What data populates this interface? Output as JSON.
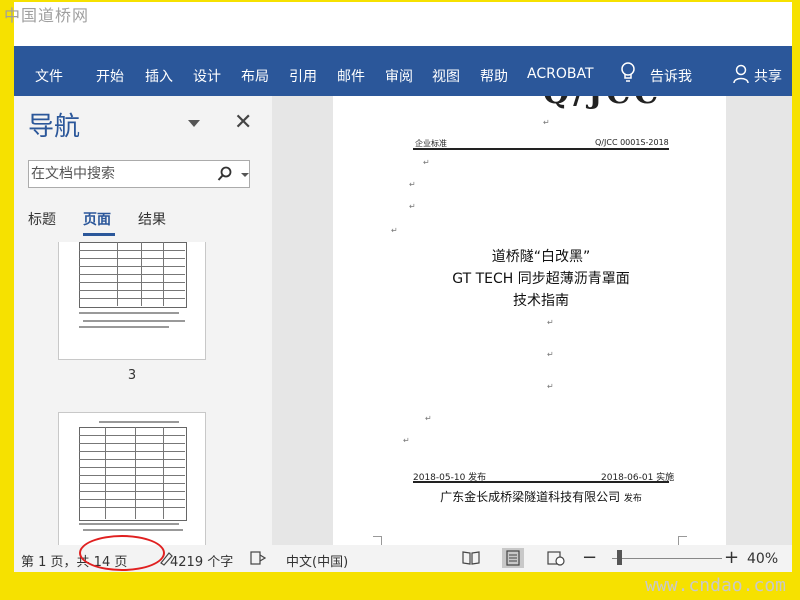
{
  "watermark_top": "中国道桥网",
  "watermark_bottom": "www.cndao.com",
  "ribbon": {
    "tabs": [
      "文件",
      "开始",
      "插入",
      "设计",
      "布局",
      "引用",
      "邮件",
      "审阅",
      "视图",
      "帮助",
      "ACROBAT"
    ],
    "tell_me": "告诉我",
    "share": "共享"
  },
  "nav": {
    "title": "导航",
    "search_placeholder": "在文档中搜索",
    "tabs": [
      "标题",
      "页面",
      "结果"
    ],
    "active_tab": "页面",
    "thumb_page_number": "3"
  },
  "document": {
    "header_title": "Q/JCC",
    "header_left": "企业标准",
    "header_right": "Q/JCC 0001S-2018",
    "title_line1": "道桥隧“白改黑”",
    "title_line2": "GT TECH 同步超薄沥青罩面",
    "title_line3": "技术指南",
    "publish_date": "2018-05-10 发布",
    "effective_date": "2018-06-01 实施",
    "company": "广东金长成桥梁隧道科技有限公司",
    "company_suffix": "发布"
  },
  "status": {
    "page_info": "第 1 页，共 14 页",
    "word_count": "4219 个字",
    "language": "中文(中国)",
    "zoom": "40%"
  },
  "accent_colors": {
    "ribbon": "#2b579a",
    "frame": "#f6e100",
    "highlight_oval": "#e02020"
  }
}
